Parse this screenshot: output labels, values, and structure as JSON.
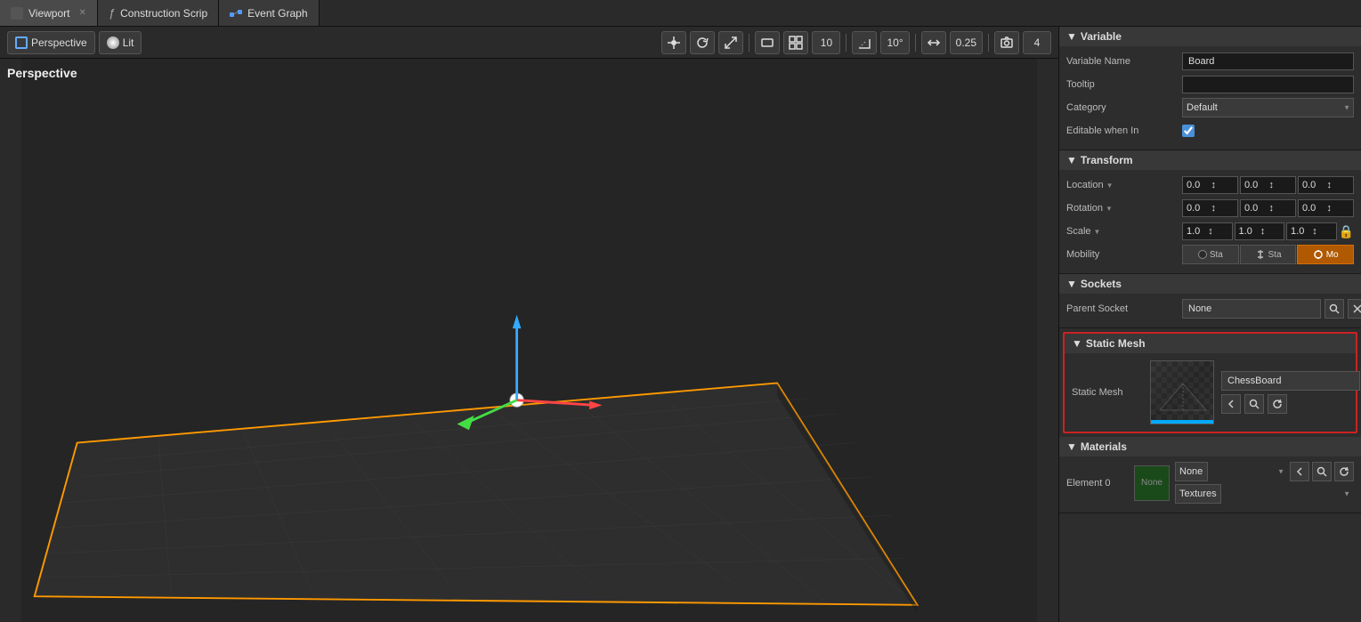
{
  "tabs": [
    {
      "id": "viewport",
      "icon": "grid",
      "label": "Viewport",
      "closable": true
    },
    {
      "id": "construction",
      "icon": "func",
      "label": "Construction Scrip",
      "closable": false
    },
    {
      "id": "event-graph",
      "icon": "graph",
      "label": "Event Graph",
      "closable": false
    }
  ],
  "viewport": {
    "perspective_label": "Perspective",
    "lit_label": "Lit",
    "toolbar": {
      "move_icon": "⊕",
      "rotate_icon": "↻",
      "scale_icon": "⤢",
      "surface_icon": "▪",
      "snap_icon": "⊞",
      "grid_icon": "⊟",
      "grid_value": "10",
      "angle_value": "10°",
      "arrow_icon": "↔",
      "snap_value": "0.25",
      "camera_icon": "📷",
      "count_value": "4"
    }
  },
  "right_panel": {
    "variable_section": {
      "title": "Variable",
      "variable_name_label": "Variable Name",
      "variable_name_value": "Board",
      "tooltip_label": "Tooltip",
      "tooltip_value": "",
      "category_label": "Category",
      "category_value": "Default",
      "editable_label": "Editable when In",
      "editable_checked": true
    },
    "transform_section": {
      "title": "Transform",
      "location_label": "Location",
      "rotation_label": "Rotation",
      "scale_label": "Scale",
      "mobility_label": "Mobility",
      "location_x": "0.0",
      "location_y": "0.0",
      "location_z": "0.0",
      "rotation_x": "0.0",
      "rotation_y": "0.0",
      "rotation_z": "0.0",
      "scale_x": "1.0",
      "scale_y": "1.0",
      "scale_z": "1.0",
      "mobility_static_label": "Sta",
      "mobility_stationary_label": "Sta",
      "mobility_movable_label": "Mo"
    },
    "sockets_section": {
      "title": "Sockets",
      "parent_socket_label": "Parent Socket",
      "parent_socket_value": "None"
    },
    "static_mesh_section": {
      "title": "Static Mesh",
      "static_mesh_label": "Static Mesh",
      "mesh_name": "ChessBoard"
    },
    "materials_section": {
      "title": "Materials",
      "element0_label": "Element 0",
      "material_value": "None",
      "textures_label": "Textures"
    }
  }
}
